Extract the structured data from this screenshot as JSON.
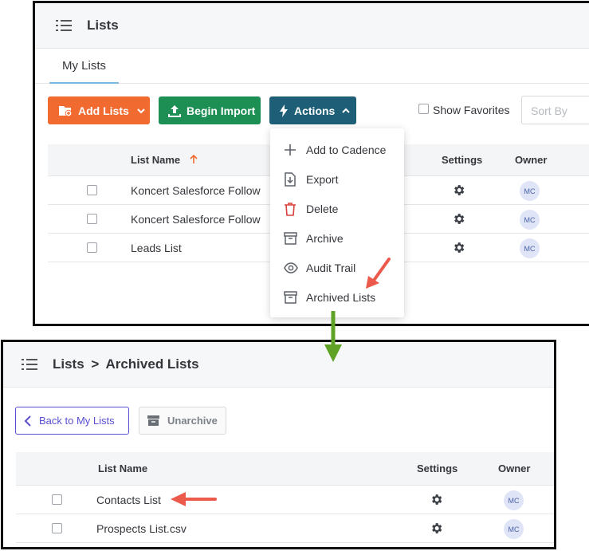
{
  "top": {
    "header": {
      "title": "Lists"
    },
    "tabs": [
      {
        "label": "My Lists"
      }
    ],
    "toolbar": {
      "add_label": "Add Lists",
      "import_label": "Begin Import",
      "actions_label": "Actions",
      "favorites_label": "Show Favorites",
      "sort_placeholder": "Sort By"
    },
    "table": {
      "columns": {
        "name": "List Name",
        "settings": "Settings",
        "owner": "Owner"
      },
      "rows": [
        {
          "name": "Koncert Salesforce Follow",
          "owner": "MC"
        },
        {
          "name": "Koncert Salesforce Follow",
          "owner": "MC"
        },
        {
          "name": "Leads List",
          "owner": "MC"
        }
      ]
    },
    "actions_menu": {
      "items": [
        {
          "label": "Add to Cadence",
          "icon": "plus-icon"
        },
        {
          "label": "Export",
          "icon": "export-icon"
        },
        {
          "label": "Delete",
          "icon": "trash-icon"
        },
        {
          "label": "Archive",
          "icon": "archive-icon"
        },
        {
          "label": "Audit Trail",
          "icon": "eye-icon"
        },
        {
          "label": "Archived Lists",
          "icon": "archive-icon"
        }
      ]
    }
  },
  "bottom": {
    "breadcrumb": {
      "root": "Lists",
      "separator": ">",
      "current": "Archived Lists"
    },
    "toolbar": {
      "back_label": "Back to My Lists",
      "unarchive_label": "Unarchive"
    },
    "table": {
      "columns": {
        "name": "List Name",
        "settings": "Settings",
        "owner": "Owner"
      },
      "rows": [
        {
          "name": "Contacts List",
          "owner": "MC"
        },
        {
          "name": "Prospects List.csv",
          "owner": "MC"
        }
      ]
    }
  },
  "colors": {
    "add_button": "#f16b31",
    "import_button": "#1d8f55",
    "actions_button": "#1e5f77",
    "delete_icon": "#d8403b",
    "annotation_arrow_red": "#ec5a4c",
    "annotation_arrow_green": "#5fa226",
    "back_button": "#5a4fd1",
    "sort_arrow": "#f16b31"
  }
}
